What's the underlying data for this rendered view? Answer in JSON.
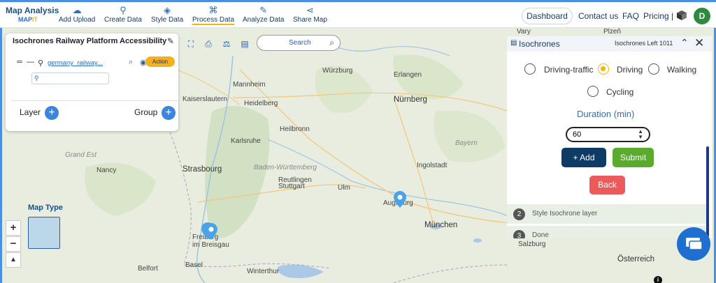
{
  "brand": {
    "title": "Map Analysis",
    "subtitle_a": "MAP",
    "subtitle_b": "IT"
  },
  "nav": {
    "items": [
      {
        "label": "Add Upload",
        "icon": "cloud-upload-icon"
      },
      {
        "label": "Create Data",
        "icon": "map-pin-icon"
      },
      {
        "label": "Style Data",
        "icon": "paint-bucket-icon"
      },
      {
        "label": "Process Data",
        "icon": "process-icon"
      },
      {
        "label": "Analyze Data",
        "icon": "analyze-icon"
      },
      {
        "label": "Share Map",
        "icon": "share-icon"
      }
    ],
    "active": "Process Data",
    "dashboard": "Dashboard",
    "contact": "Contact us",
    "faq": "FAQ",
    "pricing": "Pricing |",
    "avatar_letter": "D"
  },
  "layer_panel": {
    "title": "Isochrones Railway Platform Accessibility",
    "layer_name": "germany_railway...",
    "action_label": "Action",
    "layer_label": "Layer",
    "group_label": "Group"
  },
  "search": {
    "placeholder": "Search"
  },
  "isochrones": {
    "title": "Isochrones",
    "left_counter": "Isochrones Left 1011",
    "modes": [
      {
        "label": "Driving-traffic",
        "selected": false
      },
      {
        "label": "Driving",
        "selected": true
      },
      {
        "label": "Walking",
        "selected": false
      },
      {
        "label": "Cycling",
        "selected": false
      }
    ],
    "duration_label": "Duration (min)",
    "duration_value": "60",
    "add_label": "+ Add",
    "submit_label": "Submit",
    "back_label": "Back",
    "steps": [
      {
        "num": "2",
        "label": "Style Isochrone layer"
      },
      {
        "num": "3",
        "label": "Done"
      }
    ]
  },
  "map": {
    "cities": {
      "wurzburg": "Würzburg",
      "erlangen": "Erlangen",
      "nurnberg": "Nürnberg",
      "mannheim": "Mannheim",
      "heidelberg": "Heidelberg",
      "kaiserslautern": "Kaiserslautern",
      "heilbronn": "Heilbronn",
      "karlsruhe": "Karlsruhe",
      "nancy": "Nancy",
      "strasbourg": "Strasbourg",
      "stuttgart": "Stuttgart",
      "reutlingen": "Reutlingen",
      "ingolstadt": "Ingolstadt",
      "ulm": "Ulm",
      "augsburg": "Augsburg",
      "munchen": "München",
      "freiburg": "Freiburg",
      "im_breisgau": "im Breisgau",
      "belfort": "Belfort",
      "basel": "Basel",
      "winterthur": "Winterthur",
      "salzburg": "Salzburg",
      "osterreich": "Österreich",
      "vary": "Vary",
      "plzen": "Plzeň"
    },
    "regions": {
      "grand_est": "Grand Est",
      "bayern": "Bayern",
      "baden_wurttemberg": "Baden-Württemberg"
    },
    "map_type_label": "Map Type",
    "zoom_in": "+",
    "zoom_out": "−",
    "compass": "▲"
  }
}
